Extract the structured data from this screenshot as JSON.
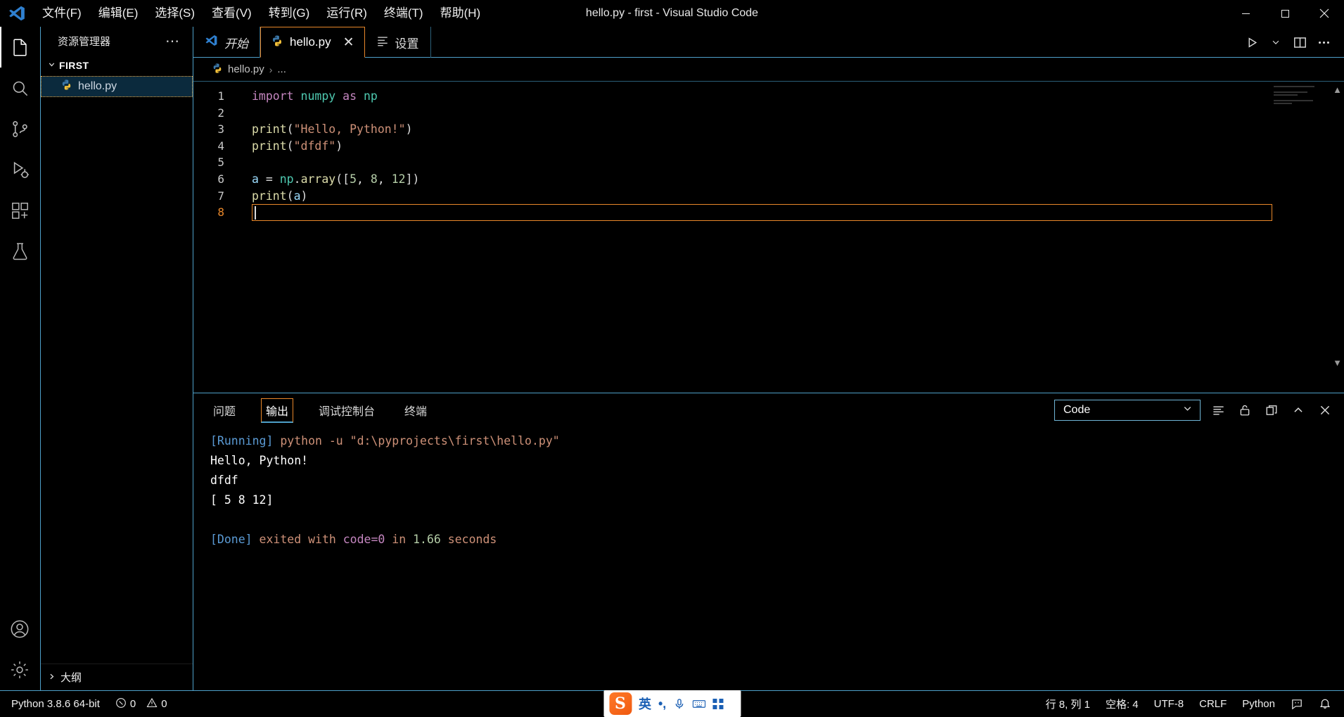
{
  "window": {
    "title": "hello.py - first - Visual Studio Code",
    "minimize_label": "─",
    "maximize_label": "☐",
    "close_label": "✕"
  },
  "menu": {
    "items": [
      {
        "label": "文件(F)",
        "name": "menu-file"
      },
      {
        "label": "编辑(E)",
        "name": "menu-edit"
      },
      {
        "label": "选择(S)",
        "name": "menu-selection"
      },
      {
        "label": "查看(V)",
        "name": "menu-view"
      },
      {
        "label": "转到(G)",
        "name": "menu-go"
      },
      {
        "label": "运行(R)",
        "name": "menu-run"
      },
      {
        "label": "终端(T)",
        "name": "menu-terminal"
      },
      {
        "label": "帮助(H)",
        "name": "menu-help"
      }
    ]
  },
  "activitybar": {
    "items": [
      {
        "icon": "explorer-icon",
        "active": true
      },
      {
        "icon": "search-icon",
        "active": false
      },
      {
        "icon": "source-control-icon",
        "active": false
      },
      {
        "icon": "run-and-debug-icon",
        "active": false
      },
      {
        "icon": "extensions-icon",
        "active": false
      },
      {
        "icon": "testing-icon",
        "active": false
      }
    ],
    "bottom": [
      {
        "icon": "account-icon"
      },
      {
        "icon": "gear-icon"
      }
    ]
  },
  "sidebar": {
    "title": "资源管理器",
    "more_actions": "⋯",
    "section": {
      "label": "FIRST",
      "chevron": "⌄",
      "expanded": true
    },
    "files": [
      {
        "label": "hello.py",
        "icon": "python-file-icon",
        "selected": true
      }
    ],
    "outline": {
      "label": "大纲",
      "chevron": "›",
      "expanded": false
    }
  },
  "editor": {
    "tabs": [
      {
        "label": "开始",
        "icon": "vscode-icon",
        "active": false,
        "closable": false
      },
      {
        "label": "hello.py",
        "icon": "python-file-icon",
        "active": true,
        "closable": true,
        "close_label": "✕"
      },
      {
        "label": "设置",
        "icon": "settings-list-icon",
        "active": false,
        "closable": false
      }
    ],
    "actions": [
      {
        "icon": "run-play-icon",
        "label": "▷"
      },
      {
        "icon": "chevron-down-icon",
        "label": "⌄"
      },
      {
        "icon": "split-editor-icon",
        "label": "◫"
      },
      {
        "icon": "more-actions-icon",
        "label": "⋯"
      }
    ],
    "breadcrumb": {
      "file": "hello.py",
      "separator": "›",
      "symbol": "..."
    },
    "code_lines": [
      {
        "number": "1",
        "tokens": [
          {
            "t": "import",
            "c": "kw"
          },
          {
            "t": " ",
            "c": "pn"
          },
          {
            "t": "numpy",
            "c": "mod"
          },
          {
            "t": " ",
            "c": "pn"
          },
          {
            "t": "as",
            "c": "kw"
          },
          {
            "t": " ",
            "c": "pn"
          },
          {
            "t": "np",
            "c": "mod"
          }
        ]
      },
      {
        "number": "2",
        "tokens": []
      },
      {
        "number": "3",
        "tokens": [
          {
            "t": "print",
            "c": "fn"
          },
          {
            "t": "(",
            "c": "pn"
          },
          {
            "t": "\"Hello, Python!\"",
            "c": "str"
          },
          {
            "t": ")",
            "c": "pn"
          }
        ]
      },
      {
        "number": "4",
        "tokens": [
          {
            "t": "print",
            "c": "fn"
          },
          {
            "t": "(",
            "c": "pn"
          },
          {
            "t": "\"dfdf\"",
            "c": "str"
          },
          {
            "t": ")",
            "c": "pn"
          }
        ]
      },
      {
        "number": "5",
        "tokens": []
      },
      {
        "number": "6",
        "tokens": [
          {
            "t": "a",
            "c": "var"
          },
          {
            "t": " = ",
            "c": "pn"
          },
          {
            "t": "np",
            "c": "mod"
          },
          {
            "t": ".",
            "c": "pn"
          },
          {
            "t": "array",
            "c": "fn"
          },
          {
            "t": "([",
            "c": "pn"
          },
          {
            "t": "5",
            "c": "num"
          },
          {
            "t": ", ",
            "c": "pn"
          },
          {
            "t": "8",
            "c": "num"
          },
          {
            "t": ", ",
            "c": "pn"
          },
          {
            "t": "12",
            "c": "num"
          },
          {
            "t": "])",
            "c": "pn"
          }
        ]
      },
      {
        "number": "7",
        "tokens": [
          {
            "t": "print",
            "c": "fn"
          },
          {
            "t": "(",
            "c": "pn"
          },
          {
            "t": "a",
            "c": "var"
          },
          {
            "t": ")",
            "c": "pn"
          }
        ]
      },
      {
        "number": "8",
        "tokens": [],
        "current": true
      }
    ]
  },
  "panel": {
    "tabs": [
      {
        "label": "问题",
        "active": false
      },
      {
        "label": "输出",
        "active": true
      },
      {
        "label": "调试控制台",
        "active": false
      },
      {
        "label": "终端",
        "active": false
      }
    ],
    "output_channel": {
      "value": "Code",
      "chevron": "⌄"
    },
    "actions": [
      {
        "icon": "clear-output-icon",
        "label": "≡"
      },
      {
        "icon": "lock-open-icon",
        "label": "⚿"
      },
      {
        "icon": "open-in-editor-icon",
        "label": "⧉"
      },
      {
        "icon": "maximize-panel-icon",
        "label": "⌃"
      },
      {
        "icon": "close-panel-icon",
        "label": "✕"
      }
    ],
    "output_lines": [
      {
        "segments": [
          {
            "t": "[Running]",
            "c": "o-tag"
          },
          {
            "t": " python -u \"d:\\pyprojects\\first\\hello.py\"",
            "c": "o-cmd"
          }
        ]
      },
      {
        "segments": [
          {
            "t": "Hello, Python!",
            "c": "o-plain"
          }
        ]
      },
      {
        "segments": [
          {
            "t": "dfdf",
            "c": "o-plain"
          }
        ]
      },
      {
        "segments": [
          {
            "t": "[ 5  8 12]",
            "c": "o-plain"
          }
        ]
      },
      {
        "segments": []
      },
      {
        "segments": [
          {
            "t": "[Done]",
            "c": "o-tag"
          },
          {
            "t": " exited with ",
            "c": "o-cmd"
          },
          {
            "t": "code=0",
            "c": "o-code"
          },
          {
            "t": " in ",
            "c": "o-cmd"
          },
          {
            "t": "1.66",
            "c": "o-num"
          },
          {
            "t": " seconds",
            "c": "o-cmd"
          }
        ]
      }
    ]
  },
  "statusbar": {
    "left": {
      "interpreter": "Python 3.8.6 64-bit",
      "errors_icon": "error-circle-icon",
      "errors": "0",
      "warnings_icon": "warning-triangle-icon",
      "warnings": "0"
    },
    "right": {
      "position": "行 8, 列 1",
      "indentation": "空格: 4",
      "encoding": "UTF-8",
      "eol": "CRLF",
      "language": "Python",
      "feedback_icon": "feedback-smiley-icon",
      "bell_icon": "bell-icon"
    }
  },
  "ime": {
    "logo": "S",
    "mode": "英",
    "punctuation": "•,",
    "mic_icon": "microphone-icon",
    "keyboard_icon": "keyboard-icon",
    "apps_icon": "apps-grid-icon"
  },
  "colors": {
    "accent_orange": "#e8872a",
    "border_blue": "#4ea0c9",
    "background": "#000000",
    "selection_blue": "#0b2a3d"
  }
}
